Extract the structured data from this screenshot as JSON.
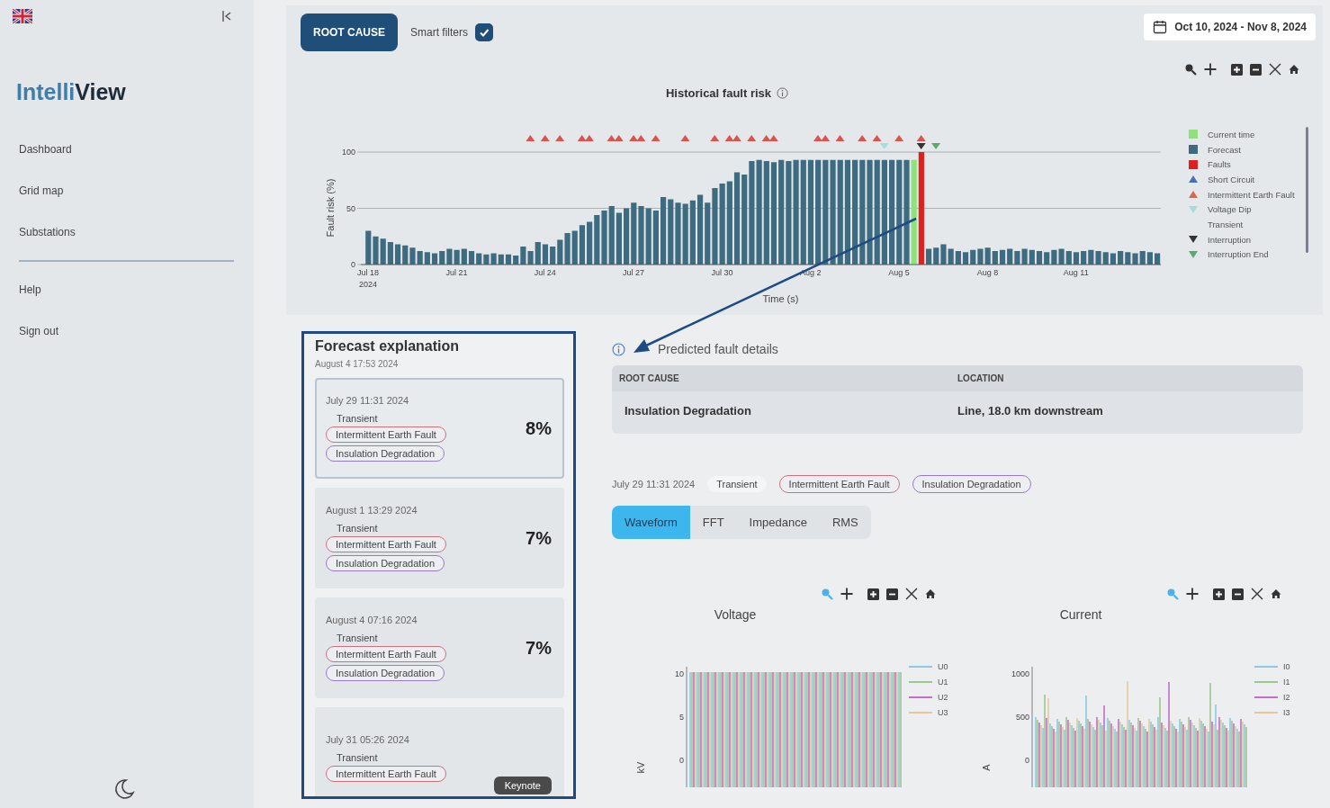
{
  "sidebar": {
    "logo": {
      "first": "Intelli",
      "second": "View"
    },
    "items": [
      {
        "label": "Dashboard"
      },
      {
        "label": "Grid map"
      },
      {
        "label": "Substations"
      }
    ],
    "footer_items": [
      {
        "label": "Help"
      },
      {
        "label": "Sign out"
      }
    ]
  },
  "toolbar": {
    "root_cause_button": "ROOT CAUSE",
    "smart_filters": {
      "label": "Smart filters",
      "checked": true
    },
    "date_range": "Oct 10, 2024 - Nov 8, 2024"
  },
  "fault_risk": {
    "zoom_selected": false,
    "year": "2024",
    "chart_data": {
      "type": "bar",
      "title": "Historical fault risk",
      "xlabel": "Time (s)",
      "ylabel": "Fault risk (%)",
      "yticks": [
        0,
        50,
        100
      ],
      "ylim": [
        0,
        100
      ],
      "categories": [
        "Jul 18",
        null,
        null,
        null,
        null,
        null,
        null,
        null,
        null,
        null,
        null,
        null,
        "Jul 21",
        null,
        null,
        null,
        null,
        null,
        null,
        null,
        null,
        null,
        null,
        null,
        "Jul 24",
        null,
        null,
        null,
        null,
        null,
        null,
        null,
        null,
        null,
        null,
        null,
        "Jul 27",
        null,
        null,
        null,
        null,
        null,
        null,
        null,
        null,
        null,
        null,
        null,
        "Jul 30",
        null,
        null,
        null,
        null,
        null,
        null,
        null,
        null,
        null,
        null,
        null,
        "Aug 2",
        null,
        null,
        null,
        null,
        null,
        null,
        null,
        null,
        null,
        null,
        null,
        "Aug 5",
        null,
        null,
        null,
        null,
        null,
        null,
        null,
        null,
        null,
        null,
        null,
        "Aug 8",
        null,
        null,
        null,
        null,
        null,
        null,
        null,
        null,
        null,
        null,
        null,
        "Aug 11",
        null,
        null,
        null,
        null,
        null,
        null,
        null,
        null,
        null,
        null,
        null
      ],
      "series": [
        {
          "name": "Current time",
          "color": "#8ee27a",
          "values": [
            null,
            null,
            null,
            null,
            null,
            null,
            null,
            null,
            null,
            null,
            null,
            null,
            null,
            null,
            null,
            null,
            null,
            null,
            null,
            null,
            null,
            null,
            null,
            null,
            null,
            null,
            null,
            null,
            null,
            null,
            null,
            null,
            null,
            null,
            null,
            null,
            null,
            null,
            null,
            null,
            null,
            null,
            null,
            null,
            null,
            null,
            null,
            null,
            null,
            null,
            null,
            null,
            null,
            null,
            null,
            null,
            null,
            null,
            null,
            null,
            null,
            null,
            null,
            null,
            null,
            null,
            null,
            null,
            null,
            null,
            null,
            null,
            null,
            null,
            93,
            null,
            null,
            null,
            null,
            null,
            null,
            null,
            null,
            null,
            null,
            null,
            null,
            null,
            null,
            null,
            null,
            null,
            null,
            null,
            null,
            null,
            null,
            null,
            null,
            null,
            null,
            null,
            null,
            null,
            null,
            null,
            null,
            null
          ]
        },
        {
          "name": "Forecast",
          "color": "#3d6b80",
          "values": [
            30,
            25,
            23,
            20,
            18,
            17,
            15,
            12,
            11,
            10,
            12,
            14,
            13,
            14,
            12,
            10,
            9,
            10,
            9,
            9,
            8,
            16,
            12,
            20,
            18,
            16,
            22,
            28,
            30,
            35,
            38,
            44,
            48,
            52,
            46,
            50,
            55,
            52,
            50,
            48,
            60,
            58,
            55,
            54,
            57,
            62,
            55,
            68,
            72,
            74,
            82,
            80,
            92,
            93,
            92,
            91,
            93,
            92,
            93,
            93,
            93,
            93,
            93,
            93,
            93,
            93,
            93,
            93,
            93,
            93,
            93,
            93,
            93,
            93,
            null,
            null,
            14,
            15,
            18,
            14,
            12,
            11,
            13,
            14,
            15,
            12,
            13,
            14,
            12,
            14,
            13,
            12,
            11,
            13,
            14,
            12,
            11,
            12,
            13,
            12,
            11,
            10,
            12,
            11,
            10,
            12,
            11,
            10
          ]
        },
        {
          "name": "Faults",
          "color": "#e02020",
          "values": [
            null,
            null,
            null,
            null,
            null,
            null,
            null,
            null,
            null,
            null,
            null,
            null,
            null,
            null,
            null,
            null,
            null,
            null,
            null,
            null,
            null,
            null,
            null,
            null,
            null,
            null,
            null,
            null,
            null,
            null,
            null,
            null,
            null,
            null,
            null,
            null,
            null,
            null,
            null,
            null,
            null,
            null,
            null,
            null,
            null,
            null,
            null,
            null,
            null,
            null,
            null,
            null,
            null,
            null,
            null,
            null,
            null,
            null,
            null,
            null,
            null,
            null,
            null,
            null,
            null,
            null,
            null,
            null,
            null,
            null,
            null,
            null,
            null,
            null,
            null,
            100,
            null,
            null,
            null,
            null,
            null,
            null,
            null,
            null,
            null,
            null,
            null,
            null,
            null,
            null,
            null,
            null,
            null,
            null,
            null,
            null,
            null,
            null,
            null,
            null,
            null,
            null,
            null,
            null,
            null,
            null,
            null,
            null
          ]
        }
      ]
    },
    "legend": [
      {
        "label": "Short Circuit",
        "kind": "up",
        "color": "#4a6fb5"
      },
      {
        "label": "Intermittent Earth Fault",
        "kind": "up",
        "color": "#d9674e"
      },
      {
        "label": "Voltage Dip",
        "kind": "down",
        "color": "#a8dcd8"
      },
      {
        "label": "Transient",
        "kind": "none"
      },
      {
        "label": "Interruption",
        "kind": "down",
        "color": "#333333"
      },
      {
        "label": "Interruption End",
        "kind": "down",
        "color": "#5cab6c"
      }
    ]
  },
  "forecast": {
    "title": "Forecast explanation",
    "subtitle": "August 4 17:53 2024",
    "tooltip": "Keynote",
    "cards": [
      {
        "date": "July 29 11:31 2024",
        "type": "Transient",
        "tags": [
          {
            "label": "Intermittent Earth Fault",
            "color": "#d0707e"
          },
          {
            "label": "Insulation Degradation",
            "color": "#9a78cc"
          }
        ],
        "pct": "8%",
        "selected": true
      },
      {
        "date": "August 1 13:29 2024",
        "type": "Transient",
        "tags": [
          {
            "label": "Intermittent Earth Fault",
            "color": "#d0707e"
          },
          {
            "label": "Insulation Degradation",
            "color": "#9a78cc"
          }
        ],
        "pct": "7%",
        "selected": false
      },
      {
        "date": "August 4 07:16 2024",
        "type": "Transient",
        "tags": [
          {
            "label": "Intermittent Earth Fault",
            "color": "#d0707e"
          },
          {
            "label": "Insulation Degradation",
            "color": "#9a78cc"
          }
        ],
        "pct": "7%",
        "selected": false
      },
      {
        "date": "July 31 05:26 2024",
        "type": "Transient",
        "tags": [
          {
            "label": "Intermittent Earth Fault",
            "color": "#d0707e"
          }
        ],
        "selected": false
      }
    ]
  },
  "details": {
    "title": "Predicted fault details",
    "columns": [
      "ROOT CAUSE",
      "LOCATION"
    ],
    "values": [
      "Insulation Degradation",
      "Line, 18.0 km downstream"
    ]
  },
  "event": {
    "date": "July 29 11:31 2024",
    "type": "Transient",
    "tags": [
      {
        "label": "Intermittent Earth Fault",
        "color": "#d0707e"
      },
      {
        "label": "Insulation Degradation",
        "color": "#9a78cc"
      }
    ],
    "tabs": [
      {
        "label": "Waveform",
        "selected": true
      },
      {
        "label": "FFT",
        "selected": false
      },
      {
        "label": "Impedance",
        "selected": false
      },
      {
        "label": "RMS",
        "selected": false
      }
    ],
    "plots": [
      {
        "kind": "voltage",
        "title": "Voltage",
        "unit": "kV",
        "zoom_selected": true,
        "yticks": [
          "10",
          "5",
          "0"
        ],
        "legend": [
          {
            "label": "U0",
            "color": "#8cc8e8"
          },
          {
            "label": "U1",
            "color": "#9cc88c"
          },
          {
            "label": "U2",
            "color": "#c070c8"
          },
          {
            "label": "U3",
            "color": "#e8c89a"
          }
        ]
      },
      {
        "kind": "current",
        "title": "Current",
        "unit": "A",
        "zoom_selected": true,
        "yticks": [
          "1000",
          "500",
          "0"
        ],
        "legend": [
          {
            "label": "I0",
            "color": "#8cc8e8"
          },
          {
            "label": "I1",
            "color": "#9cc88c"
          },
          {
            "label": "I2",
            "color": "#c070c8"
          },
          {
            "label": "I3",
            "color": "#e8c89a"
          }
        ]
      }
    ]
  }
}
